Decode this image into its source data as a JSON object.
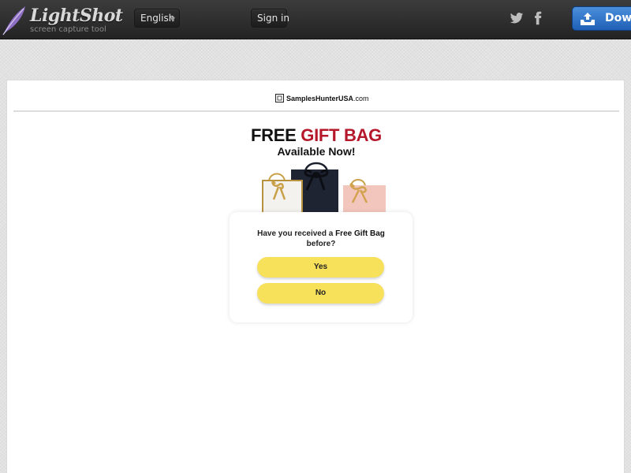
{
  "topbar": {
    "app_name": "LightShot",
    "tagline": "screen capture tool",
    "language": "English",
    "sign_in": "Sign in",
    "download_label": "Down",
    "icons": {
      "logo": "feather-icon",
      "twitter": "twitter-icon",
      "facebook": "facebook-icon",
      "download": "tray-upload-icon",
      "language_caret": "chevron-down-icon"
    }
  },
  "page": {
    "site": {
      "brand": "SamplesHunterUSA",
      "domain_suffix": ".com"
    },
    "headline": {
      "part1": "FREE",
      "part2": "GIFT BAG",
      "accent_color": "#b5182a"
    },
    "subheadline": "Available Now!",
    "quiz": {
      "question_part1": "Have you received a ",
      "question_highlight": "Free Gift Bag",
      "question_part2": " before?",
      "yes": "Yes",
      "no": "No",
      "button_color": "#f7e05a"
    }
  }
}
